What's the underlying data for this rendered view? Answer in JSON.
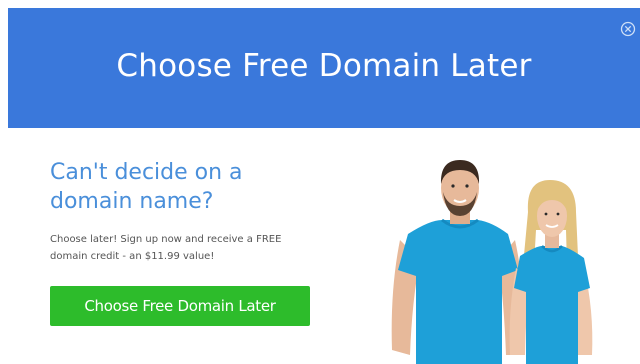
{
  "header": {
    "title": "Choose Free Domain Later"
  },
  "content": {
    "headline": "Can't decide on a domain name?",
    "blurb": "Choose later! Sign up now and receive a FREE domain credit - an $11.99 value!",
    "cta_label": "Choose Free Domain Later"
  },
  "colors": {
    "header_bg": "#3a78db",
    "headline": "#4a8fda",
    "cta_bg": "#2dbc2b",
    "shirt": "#1ea0d8"
  },
  "icons": {
    "close": "close-circle-icon"
  }
}
